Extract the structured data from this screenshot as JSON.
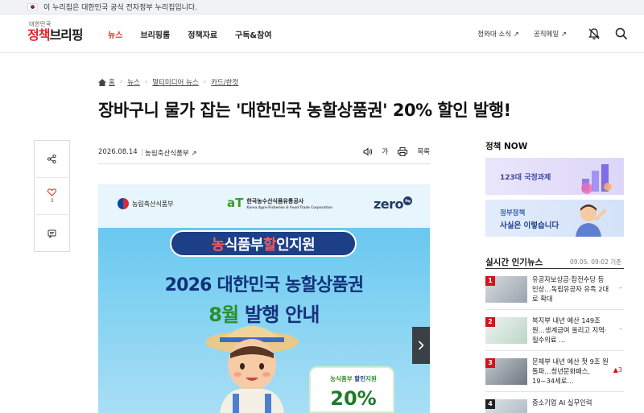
{
  "gov_banner": {
    "text": "이 누리집은 대한민국 공식 전자정부 누리집입니다."
  },
  "logo": {
    "small": "대한민국",
    "main_a": "정책",
    "main_b": "브리핑"
  },
  "nav": [
    {
      "label": "뉴스",
      "active": true
    },
    {
      "label": "브리핑룸",
      "active": false
    },
    {
      "label": "정책자료",
      "active": false
    },
    {
      "label": "구독&참여",
      "active": false
    }
  ],
  "util_links": [
    "청와대 소식 ↗",
    "공직메일 ↗"
  ],
  "icons": {
    "alarm": "bell-off-icon",
    "search": "search-icon",
    "share": "share-icon",
    "like": "heart-icon",
    "comment": "comment-icon",
    "home": "home-icon"
  },
  "breadcrumb": [
    "홈",
    "뉴스",
    "멀티미디어 뉴스",
    "카드/한컷"
  ],
  "article": {
    "title": "장바구니 물가 잡는 '대한민국 농할상품권' 20% 할인 발행!",
    "date": "2026.08.14",
    "source": "농림축산식품부 ↗",
    "likes": "3",
    "tools": {
      "font": "가",
      "list": "목록"
    }
  },
  "hero": {
    "ministry": "농림축산식품부",
    "at_mark": "aT",
    "at_name": "한국농수산식품유통공사",
    "at_sub": "Korea Agro-Fisheries & Food Trade Corporation",
    "zero": "zero",
    "pay": "Pay",
    "pill_a": "농",
    "pill_b": "식품부 ",
    "pill_c": "할",
    "pill_d": "인지원",
    "line1": "2026 대한민국 농할상품권",
    "line2_a": "8월",
    "line2_b": " 발행 안내",
    "coupon_a": "농식품부 ",
    "coupon_b": "할인",
    "coupon_c": "지원",
    "coupon_value": "20%"
  },
  "sidebar": {
    "policy_now": "정책 NOW",
    "banner1": "123대 국정과제",
    "banner2_t1": "정부정책",
    "banner2_t2": "사실은 이렇습니다",
    "realtime_title": "실시간 인기뉴스",
    "realtime_time": "09.05. 09:02 기준",
    "items": [
      {
        "rank": "1",
        "text": "유공자보상금·참전수당 등 인상…독립유공자 유족 2대로 확대",
        "change": "–"
      },
      {
        "rank": "2",
        "text": "복지부 내년 예산 149조 원…생계급여 올리고 지역·필수의료 …",
        "change": "–"
      },
      {
        "rank": "3",
        "text": "문체부 내년 예산 첫 9조 원 돌파…청년문화패스, 19~34세로…",
        "change": "▲3"
      },
      {
        "rank": "4",
        "text": "중소기업 AI 실무인력",
        "change": ""
      }
    ]
  },
  "colors": {
    "accent": "#e3262e",
    "navy": "#1d3f88",
    "green": "#2b8f2c"
  }
}
